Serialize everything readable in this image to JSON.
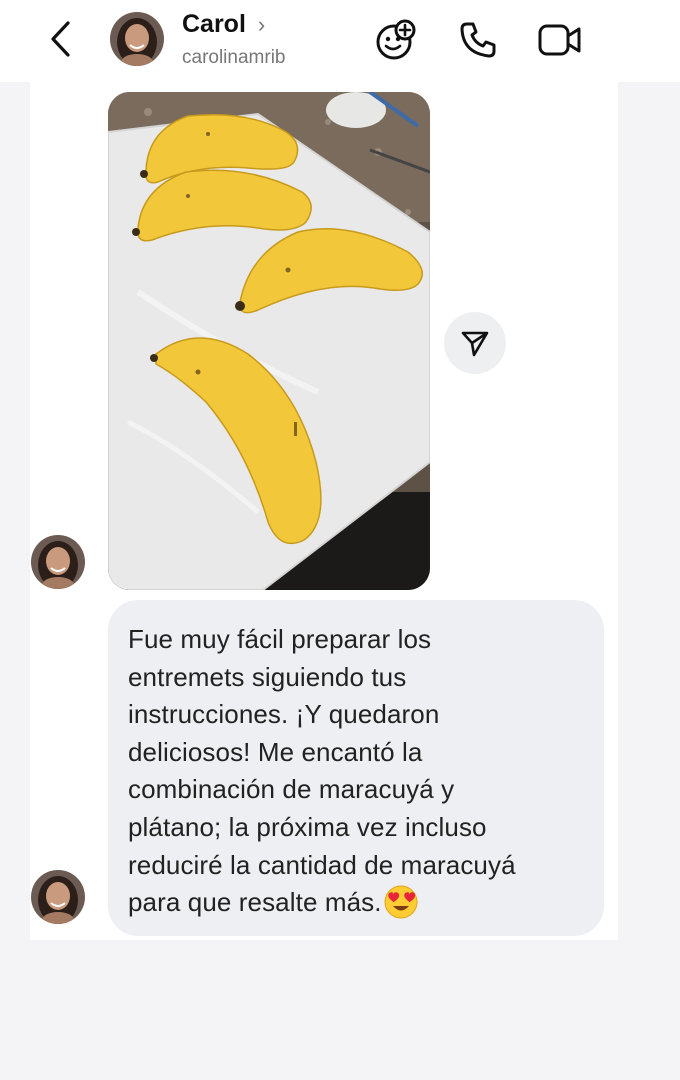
{
  "header": {
    "name": "Carol",
    "name_chevron": "›",
    "username": "carolinamrib",
    "icons": [
      "back-arrow-icon",
      "avatar",
      "sticker-add-icon",
      "phone-icon",
      "video-camera-icon"
    ]
  },
  "messages": [
    {
      "type": "photo",
      "description_icon": "bananas-photo",
      "share_icon": "paper-plane-icon"
    },
    {
      "type": "text",
      "text": "Fue muy fácil preparar los\nentremets siguiendo tus\ninstrucciones. ¡Y quedaron\ndeliciosos! Me encantó la\ncombinación de maracuyá y\nplátano; la próxima vez incluso\nreduciré la cantidad de maracuyá\npara que resalte más.",
      "emoji": "heart-eyes-emoji"
    }
  ],
  "colors": {
    "background": "#f4f4f6",
    "bubble": "#eeeff2",
    "banana": "#f2c73a",
    "board": "#e9e9e9"
  }
}
